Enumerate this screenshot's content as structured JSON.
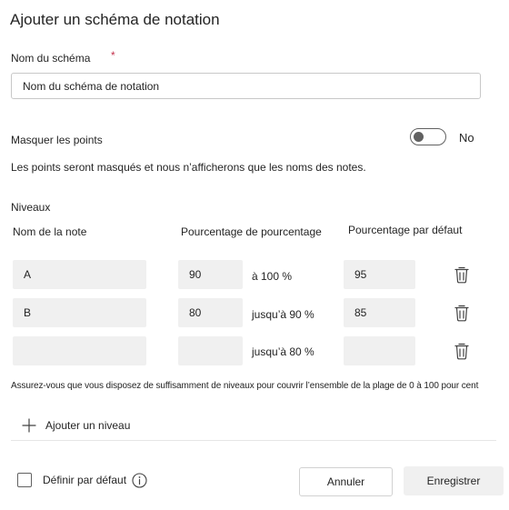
{
  "dialog": {
    "title": "Ajouter un schéma de notation"
  },
  "scheme_name": {
    "label": "Nom du schéma",
    "required_mark": "*",
    "value": "Nom du schéma de notation"
  },
  "hide_points": {
    "label": "Masquer les points",
    "state_label": "No",
    "enabled": false,
    "help_text": "Les points seront masqués et nous n’afficherons que les noms des notes."
  },
  "levels": {
    "section_label": "Niveaux",
    "columns": {
      "grade_name": "Nom de la note",
      "percentage": "Pourcentage de pourcentage",
      "default_percentage": "Pourcentage par défaut"
    },
    "rows": [
      {
        "name": "A",
        "percentage": "90",
        "range": "à 100 %",
        "default": "95"
      },
      {
        "name": "B",
        "percentage": "80",
        "range": "jusqu’à 90 %",
        "default": "85"
      },
      {
        "name": "",
        "percentage": "",
        "range": "jusqu’à 80 %",
        "default": ""
      }
    ],
    "coverage_note": "Assurez-vous que vous disposez de suffisamment de niveaux pour couvrir l’ensemble de la plage de 0 à 100 pour cent",
    "add_level_label": "Ajouter un niveau"
  },
  "footer": {
    "default_label": "Définir par défaut",
    "default_checked": false,
    "cancel_label": "Annuler",
    "save_label": "Enregistrer"
  },
  "colors": {
    "required": "#c4314b",
    "input_fill": "#f0f0f0",
    "text": "#242424"
  }
}
